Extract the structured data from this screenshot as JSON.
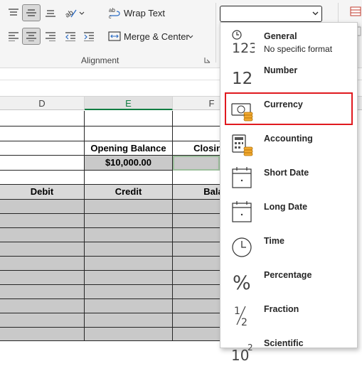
{
  "ribbon": {
    "wrap_text_label": "Wrap Text",
    "merge_center_label": "Merge & Center",
    "group_label": "Alignment",
    "number_format_value": ""
  },
  "columns": [
    "D",
    "E",
    "F"
  ],
  "sheet": {
    "opening_balance_label": "Opening Balance",
    "closing_balance_label": "Closing B",
    "opening_balance_value": "$10,000.00",
    "debit_header": "Debit",
    "credit_header": "Credit",
    "balance_header": "Balar"
  },
  "dropdown": {
    "items": [
      {
        "label": "General",
        "sub": "No specific format",
        "icon": "clock-123-icon"
      },
      {
        "label": "Number",
        "sub": "",
        "icon": "number-12-icon"
      },
      {
        "label": "Currency",
        "sub": "",
        "icon": "currency-icon"
      },
      {
        "label": "Accounting",
        "sub": "",
        "icon": "accounting-icon"
      },
      {
        "label": "Short Date",
        "sub": "",
        "icon": "short-date-icon"
      },
      {
        "label": "Long Date",
        "sub": "",
        "icon": "long-date-icon"
      },
      {
        "label": "Time",
        "sub": "",
        "icon": "clock-icon"
      },
      {
        "label": "Percentage",
        "sub": "",
        "icon": "percent-icon"
      },
      {
        "label": "Fraction",
        "sub": "",
        "icon": "fraction-icon"
      },
      {
        "label": "Scientific",
        "sub": "",
        "icon": "scientific-icon"
      }
    ],
    "icon_text": {
      "general": "123",
      "number": "12",
      "percent": "%",
      "fraction_num": "1",
      "fraction_den": "2",
      "sci_base": "10",
      "sci_exp": "2"
    }
  },
  "colors": {
    "highlight": "#e0191f",
    "selected_fill": "#c9c9c9",
    "active_column": "#107c41"
  }
}
